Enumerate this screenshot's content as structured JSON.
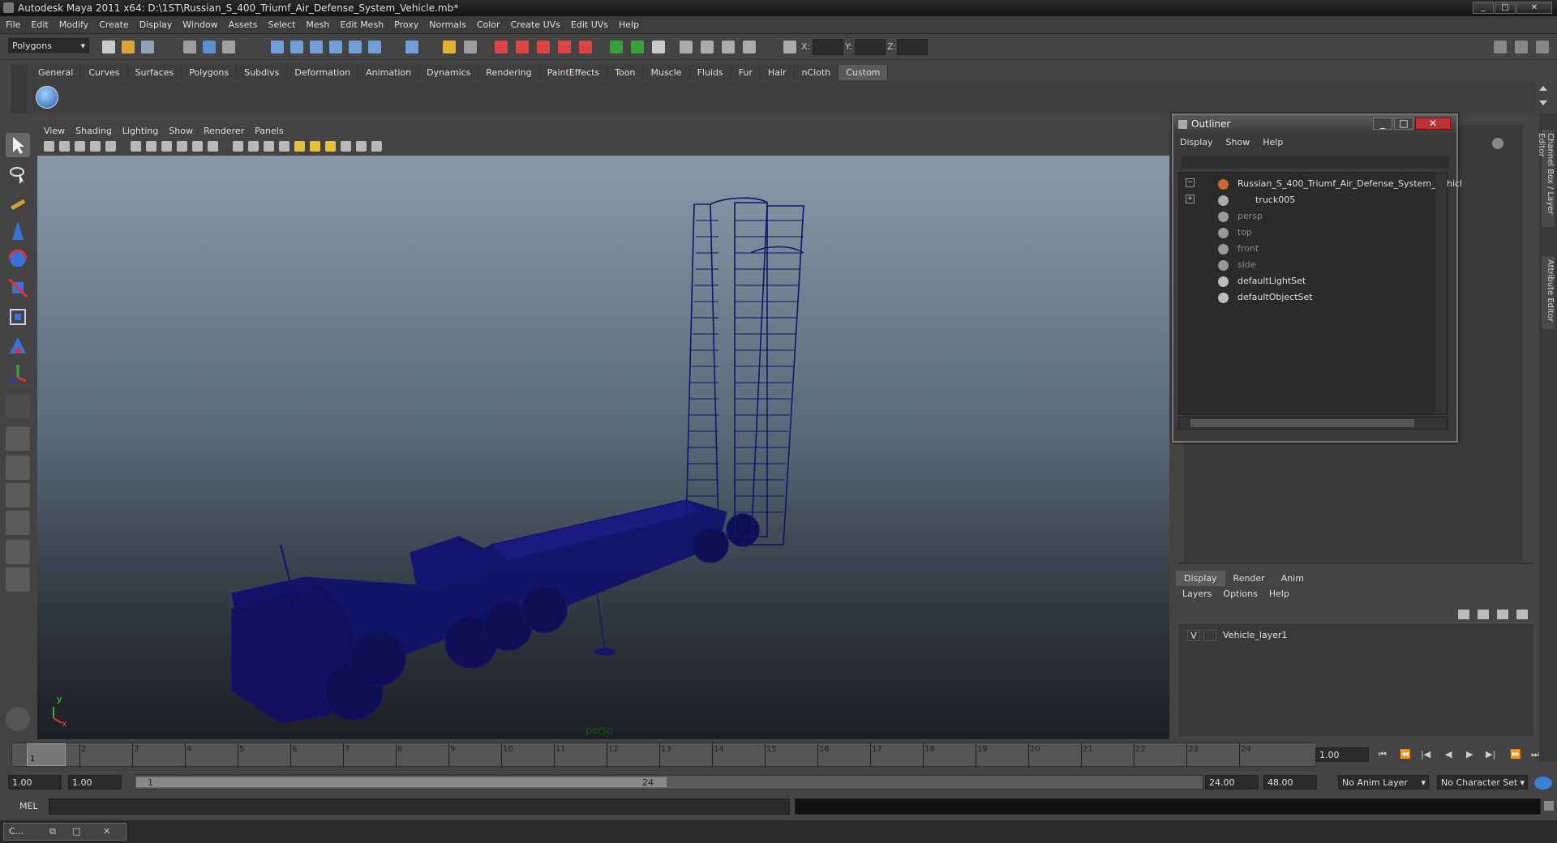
{
  "window": {
    "title": "Autodesk Maya 2011 x64: D:\\1ST\\Russian_S_400_Triumf_Air_Defense_System_Vehicle.mb*",
    "min": "_",
    "max": "□",
    "close": "✕"
  },
  "menubar": [
    "File",
    "Edit",
    "Modify",
    "Create",
    "Display",
    "Window",
    "Assets",
    "Select",
    "Mesh",
    "Edit Mesh",
    "Proxy",
    "Normals",
    "Color",
    "Create UVs",
    "Edit UVs",
    "Help"
  ],
  "statusline": {
    "mode": "Polygons",
    "x_label": "X:",
    "y_label": "Y:",
    "z_label": "Z:"
  },
  "shelf_tabs": [
    "General",
    "Curves",
    "Surfaces",
    "Polygons",
    "Subdivs",
    "Deformation",
    "Animation",
    "Dynamics",
    "Rendering",
    "PaintEffects",
    "Toon",
    "Muscle",
    "Fluids",
    "Fur",
    "Hair",
    "nCloth",
    "Custom"
  ],
  "shelf_active": "Custom",
  "viewport": {
    "menu": [
      "View",
      "Shading",
      "Lighting",
      "Show",
      "Renderer",
      "Panels"
    ],
    "camera": "persp",
    "axis_x": "x",
    "axis_y": "y"
  },
  "outliner": {
    "title": "Outliner",
    "menu": [
      "Display",
      "Show",
      "Help"
    ],
    "items": [
      {
        "label": "Russian_S_400_Triumf_Air_Defense_System_Vehicl",
        "expander": "−",
        "kind": "group"
      },
      {
        "label": "truck005",
        "expander": "+",
        "kind": "mesh"
      },
      {
        "label": "persp",
        "expander": "",
        "kind": "camera"
      },
      {
        "label": "top",
        "expander": "",
        "kind": "camera"
      },
      {
        "label": "front",
        "expander": "",
        "kind": "camera"
      },
      {
        "label": "side",
        "expander": "",
        "kind": "camera"
      },
      {
        "label": "defaultLightSet",
        "expander": "",
        "kind": "set"
      },
      {
        "label": "defaultObjectSet",
        "expander": "",
        "kind": "set"
      }
    ]
  },
  "side_tabs": [
    "Channel Box / Layer Editor",
    "Attribute Editor"
  ],
  "layer_editor": {
    "tabs": [
      "Display",
      "Render",
      "Anim"
    ],
    "active": "Display",
    "menu": [
      "Layers",
      "Options",
      "Help"
    ],
    "layers": [
      {
        "visible": "V",
        "name": "Vehicle_layer1"
      }
    ]
  },
  "timeline": {
    "ticks": [
      "1",
      "2",
      "3",
      "4",
      "5",
      "6",
      "7",
      "8",
      "9",
      "10",
      "11",
      "12",
      "13",
      "14",
      "15",
      "16",
      "17",
      "18",
      "19",
      "20",
      "21",
      "22",
      "23",
      "24"
    ],
    "current_frame": "1",
    "current_time": "1.00"
  },
  "range": {
    "start": "1.00",
    "playback_start": "1.00",
    "slider_start": "1",
    "slider_end": "24",
    "playback_end": "24.00",
    "end": "48.00",
    "anim_layer": "No Anim Layer",
    "char_set": "No Character Set"
  },
  "cmdline": {
    "label": "MEL"
  },
  "taskbar": {
    "item": "C..."
  },
  "colors": {
    "wire": "#14146e",
    "accent": "#5a5a5a"
  }
}
